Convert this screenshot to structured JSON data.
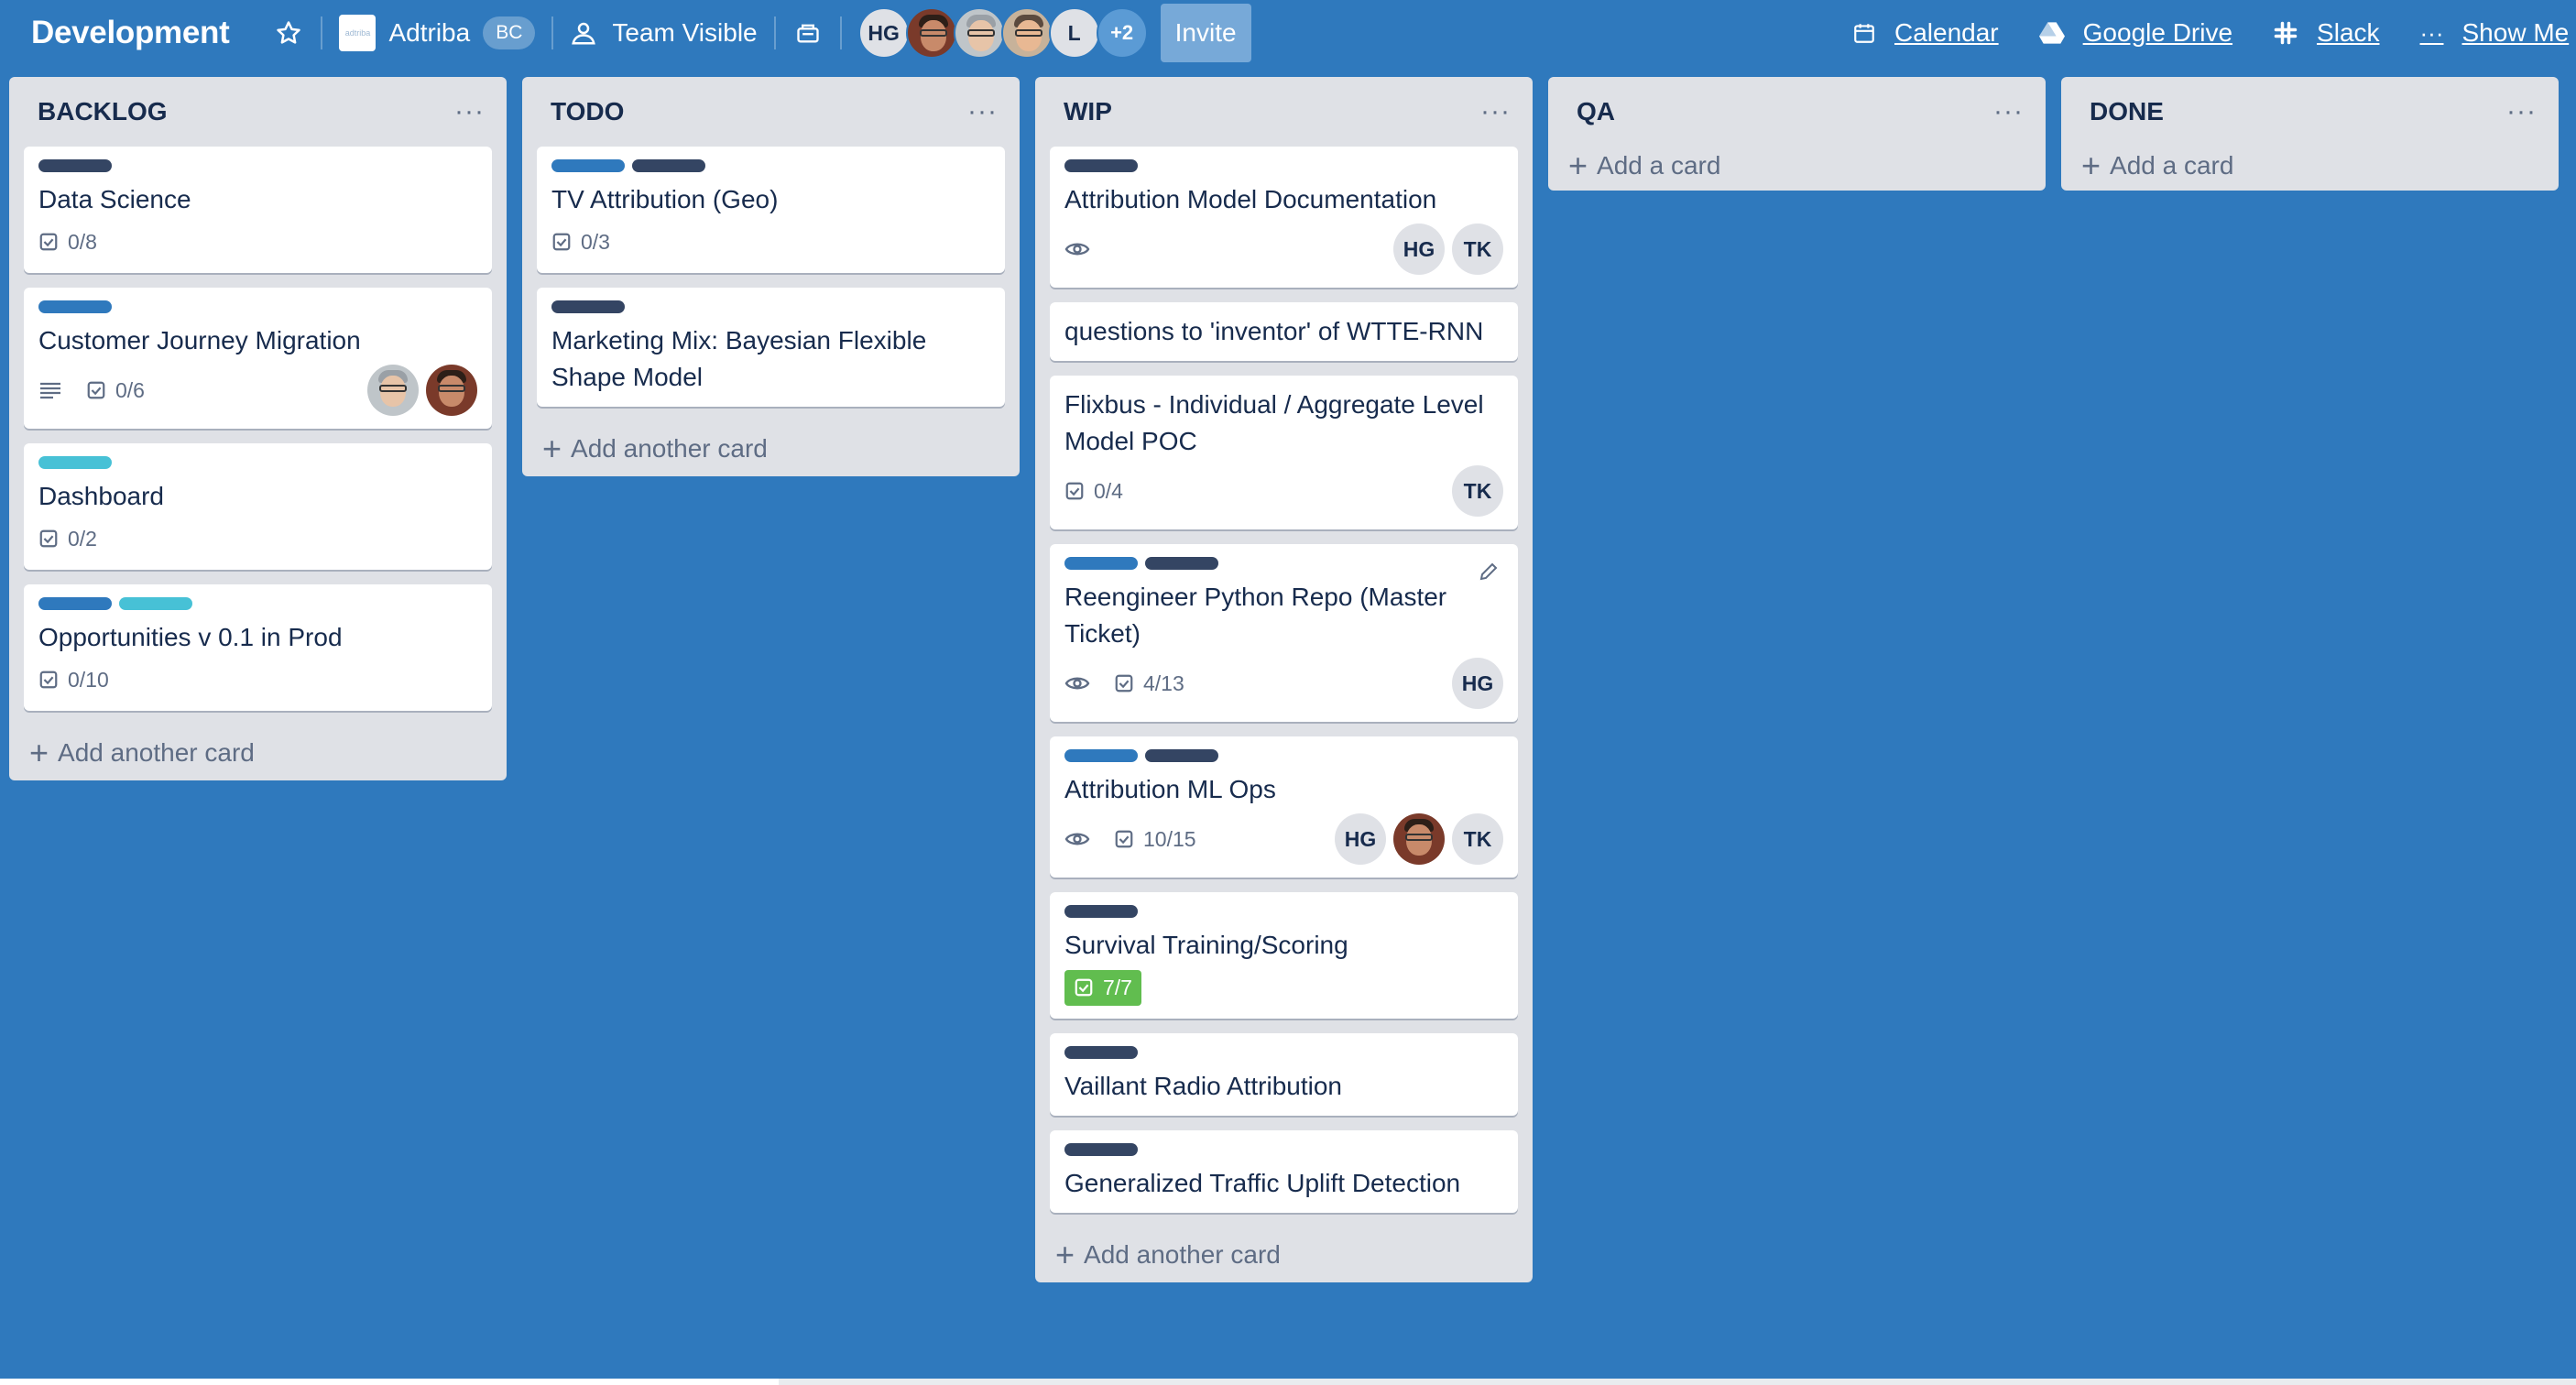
{
  "header": {
    "board_title": "Development",
    "org": {
      "logo_text": "adtriba",
      "name": "Adtriba",
      "badge": "BC"
    },
    "visibility": "Team Visible",
    "members": [
      "HG",
      "",
      "",
      "",
      "L"
    ],
    "members_more": "+2",
    "invite_label": "Invite",
    "links": {
      "calendar": "Calendar",
      "google_drive": "Google Drive",
      "slack": "Slack",
      "show_menu": "Show Me"
    }
  },
  "colors": {
    "board_bg": "#2f79bd",
    "label_dark": "#344563",
    "label_blue": "#2f79bd",
    "label_sky": "#47c1d6",
    "complete_green": "#61bd4f"
  },
  "lists": [
    {
      "title": "BACKLOG",
      "add_label": "Add another card",
      "cards": [
        {
          "labels": [
            "dark"
          ],
          "title": "Data Science",
          "checklist": "0/8"
        },
        {
          "labels": [
            "blue"
          ],
          "title": "Customer Journey Migration",
          "description": true,
          "checklist": "0/6",
          "members": [
            "photo-grey",
            "photo-dark"
          ]
        },
        {
          "labels": [
            "sky"
          ],
          "title": "Dashboard",
          "checklist": "0/2"
        },
        {
          "labels": [
            "blue",
            "sky"
          ],
          "title": "Opportunities v 0.1 in Prod",
          "checklist": "0/10"
        }
      ]
    },
    {
      "title": "TODO",
      "add_label": "Add another card",
      "cards": [
        {
          "labels": [
            "blue",
            "dark"
          ],
          "title": "TV Attribution (Geo)",
          "checklist": "0/3"
        },
        {
          "labels": [
            "dark"
          ],
          "title": "Marketing Mix: Bayesian Flexible Shape Model"
        }
      ]
    },
    {
      "title": "WIP",
      "add_label": "Add another card",
      "cards": [
        {
          "labels": [
            "dark"
          ],
          "title": "Attribution Model Documentation",
          "watch": true,
          "members": [
            "HG",
            "TK"
          ]
        },
        {
          "labels": [],
          "title": "questions to 'inventor' of WTTE-RNN"
        },
        {
          "labels": [],
          "title": "Flixbus - Individual / Aggregate Level Model POC",
          "checklist": "0/4",
          "members": [
            "TK"
          ]
        },
        {
          "labels": [
            "blue",
            "dark"
          ],
          "title": "Reengineer Python Repo (Master Ticket)",
          "watch": true,
          "checklist": "4/13",
          "members": [
            "HG"
          ],
          "editing": true
        },
        {
          "labels": [
            "blue",
            "dark"
          ],
          "title": "Attribution ML Ops",
          "watch": true,
          "checklist": "10/15",
          "members": [
            "HG",
            "photo-dark",
            "TK"
          ]
        },
        {
          "labels": [
            "dark"
          ],
          "title": "Survival Training/Scoring",
          "checklist": "7/7",
          "checklist_complete": true
        },
        {
          "labels": [
            "dark"
          ],
          "title": "Vaillant Radio Attribution"
        },
        {
          "labels": [
            "dark"
          ],
          "title": "Generalized Traffic Uplift Detection"
        }
      ]
    },
    {
      "title": "QA",
      "add_label": "Add a card",
      "cards": []
    },
    {
      "title": "DONE",
      "add_label": "Add a card",
      "cards": []
    }
  ]
}
